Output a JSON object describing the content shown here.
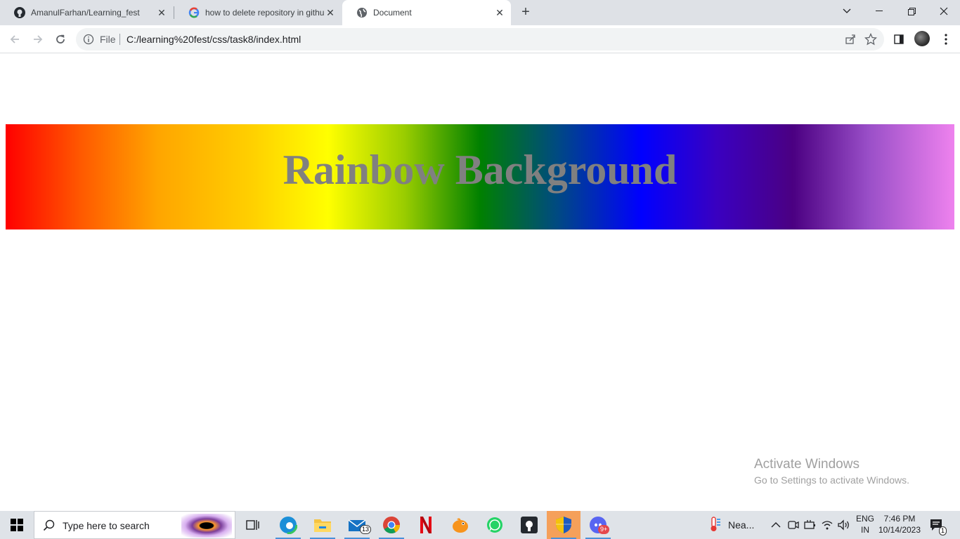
{
  "browser": {
    "tabs": [
      {
        "title": "AmanulFarhan/Learning_fest",
        "icon": "github-icon"
      },
      {
        "title": "how to delete repository in githu",
        "icon": "google-icon"
      },
      {
        "title": "Document",
        "icon": "globe-icon"
      }
    ],
    "address": {
      "scheme_label": "File",
      "url": "C:/learning%20fest/css/task8/index.html"
    }
  },
  "page": {
    "heading": "Rainbow Background",
    "gradient_colors": [
      "#ff0000",
      "#ffa500",
      "#ffff00",
      "#008000",
      "#0000ff",
      "#4b0082",
      "#ee82ee"
    ],
    "heading_color": "#808080"
  },
  "watermark": {
    "title": "Activate Windows",
    "subtitle": "Go to Settings to activate Windows."
  },
  "taskbar": {
    "search_placeholder": "Type here to search",
    "mail_badge": "13",
    "discord_badge": "9+",
    "weather_label": "Nea...",
    "lang_line1": "ENG",
    "lang_line2": "IN",
    "time": "7:46 PM",
    "date": "10/14/2023",
    "notification_count": "1"
  }
}
